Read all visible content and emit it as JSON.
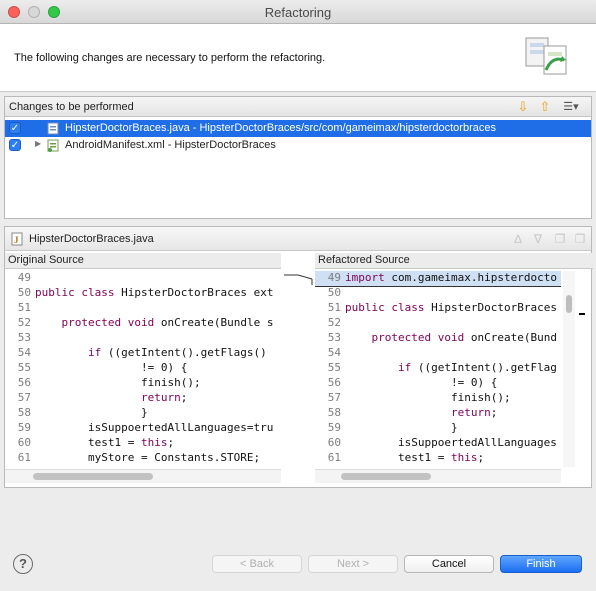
{
  "window": {
    "title": "Refactoring",
    "controls": [
      "close",
      "minimize",
      "zoom"
    ],
    "control_colors": {
      "close": "#fc605b",
      "minimize": "#d8d8d8",
      "zoom": "#34c84a"
    }
  },
  "header": {
    "message": "The following changes are necessary to perform the refactoring.",
    "icon": "refactoring-wizard-icon"
  },
  "changes": {
    "title": "Changes to be performed",
    "toolbar": [
      "next-change-icon",
      "previous-change-icon",
      "filter-changes-icon"
    ],
    "items": [
      {
        "label": "HipsterDoctorBraces.java - HipsterDoctorBraces/src/com/gameimax/hipsterdoctorbraces",
        "checked": true,
        "selected": true,
        "icon": "java-file-icon"
      },
      {
        "label": "AndroidManifest.xml - HipsterDoctorBraces",
        "checked": true,
        "selected": false,
        "icon": "xml-file-icon"
      }
    ]
  },
  "compare": {
    "file": "HipsterDoctorBraces.java",
    "original_title": "Original Source",
    "refactored_title": "Refactored Source",
    "original_lines": [
      {
        "n": "49",
        "t": ""
      },
      {
        "n": "50",
        "t": "public class HipsterDoctorBraces ext"
      },
      {
        "n": "51",
        "t": ""
      },
      {
        "n": "52",
        "t": "    protected void onCreate(Bundle s"
      },
      {
        "n": "53",
        "t": ""
      },
      {
        "n": "54",
        "t": "        if ((getIntent().getFlags()"
      },
      {
        "n": "55",
        "t": "                != 0) {"
      },
      {
        "n": "56",
        "t": "                finish();"
      },
      {
        "n": "57",
        "t": "                return;"
      },
      {
        "n": "58",
        "t": "                }"
      },
      {
        "n": "59",
        "t": "        isSuppoertedAllLanguages=tru"
      },
      {
        "n": "60",
        "t": "        test1 = this;"
      },
      {
        "n": "61",
        "t": "        myStore = Constants.STORE;"
      }
    ],
    "refactored_lines": [
      {
        "n": "49",
        "t": "import com.gameimax.hipsterdocto"
      },
      {
        "n": "50",
        "t": ""
      },
      {
        "n": "51",
        "t": "public class HipsterDoctorBraces"
      },
      {
        "n": "52",
        "t": ""
      },
      {
        "n": "53",
        "t": "    protected void onCreate(Bund"
      },
      {
        "n": "54",
        "t": ""
      },
      {
        "n": "55",
        "t": "        if ((getIntent().getFlag"
      },
      {
        "n": "56",
        "t": "                != 0) {"
      },
      {
        "n": "57",
        "t": "                finish();"
      },
      {
        "n": "58",
        "t": "                return;"
      },
      {
        "n": "59",
        "t": "                }"
      },
      {
        "n": "60",
        "t": "        isSuppoertedAllLanguages"
      },
      {
        "n": "61",
        "t": "        test1 = this;"
      }
    ]
  },
  "buttons": {
    "help": "?",
    "back": "< Back",
    "next": "Next >",
    "cancel": "Cancel",
    "finish": "Finish"
  }
}
